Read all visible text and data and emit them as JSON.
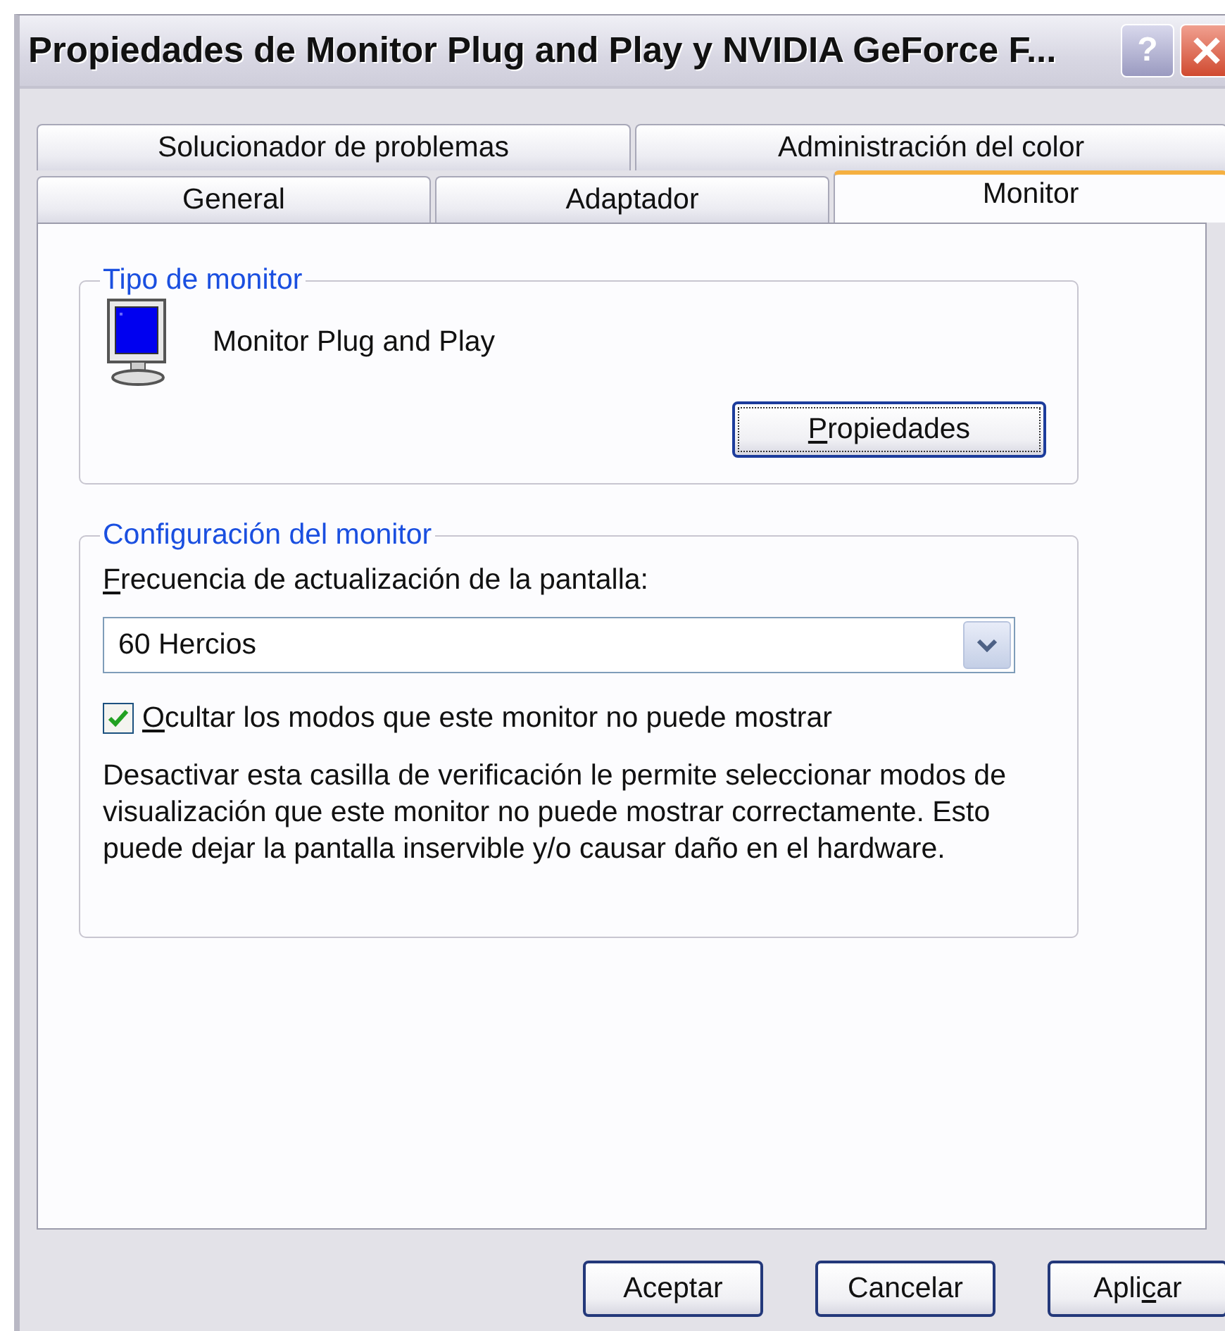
{
  "window": {
    "title": "Propiedades de Monitor Plug and Play y NVIDIA GeForce F...",
    "help_button": "?"
  },
  "tab_rows": [
    {
      "tabs": [
        {
          "label": "Solucionador de problemas",
          "selected": false
        },
        {
          "label": "Administración del color",
          "selected": false
        }
      ]
    },
    {
      "tabs": [
        {
          "label": "General",
          "selected": false
        },
        {
          "label": "Adaptador",
          "selected": false
        },
        {
          "label": "Monitor",
          "selected": true
        }
      ]
    }
  ],
  "monitor_type": {
    "legend": "Tipo de monitor",
    "name": "Monitor Plug and Play",
    "button": {
      "label": [
        {
          "text": "P",
          "underlined": true
        },
        {
          "text": "ropiedades",
          "underlined": false
        }
      ],
      "focused": true
    }
  },
  "monitor_settings": {
    "legend": "Configuración del monitor",
    "refresh_label": [
      {
        "text": "F",
        "underlined": true
      },
      {
        "text": "recuencia de actualización de la pantalla:",
        "underlined": false
      }
    ],
    "refresh_select": {
      "value": "60 Hercios"
    },
    "hide_modes": {
      "label": [
        {
          "text": "O",
          "underlined": true
        },
        {
          "text": "cultar los modos que este monitor no puede mostrar",
          "underlined": false
        }
      ],
      "checked": true
    },
    "description": "Desactivar esta casilla de verificación le permite seleccionar modos de visualización que este monitor no puede mostrar correctamente. Esto puede dejar la pantalla inservible y/o causar daño en el hardware."
  },
  "buttons": [
    {
      "label": [
        {
          "text": "Aceptar",
          "underlined": false
        }
      ]
    },
    {
      "label": [
        {
          "text": "Cancelar",
          "underlined": false
        }
      ]
    },
    {
      "label": [
        {
          "text": "Apli",
          "underlined": false
        },
        {
          "text": "c",
          "underlined": true
        },
        {
          "text": "ar",
          "underlined": false
        }
      ]
    }
  ]
}
